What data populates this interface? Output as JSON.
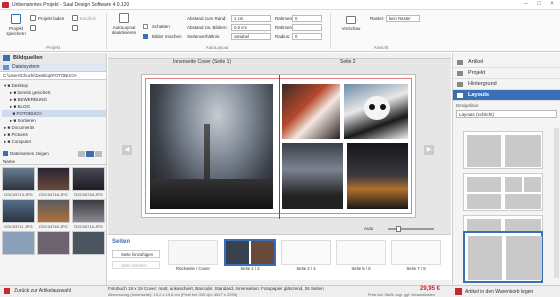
{
  "app": {
    "title": "Unbenanntes Projekt - Saal Design Software 4.0.120"
  },
  "ribbon": {
    "project": {
      "save": "Projekt speichern",
      "load": "Projekt laden",
      "recent": "Kürzlich",
      "group": "Projekt"
    },
    "autolayout": {
      "btn": "AutoLayout deaktivieren",
      "shadows": "Schatten",
      "images_mix": "Bilder mischen",
      "group": "AutoLayout",
      "edge_label": "Abstand zum Rand:",
      "edge_val": "1 cm",
      "between_label": "Abstand zw. Bildern:",
      "between_val": "0,5 cm",
      "ratio_label": "Seitenverhältnis:",
      "ratio_val": "variabel",
      "frame_label": "Rahmendicke:",
      "frame_val": "0",
      "framecolor_label": "Rahmenfarbe:",
      "radius_label": "Radius:",
      "radius_val": "0"
    },
    "view": {
      "preview": "Vorschau",
      "grid_label": "Raster:",
      "grid_val": "kein Raster",
      "group": "Ansicht"
    }
  },
  "left": {
    "title": "Bildquellen",
    "filesystem": "Dateisystem",
    "path": "C:\\Users\\Chuchi\\Desktop\\FOTOBUCH",
    "tree": [
      "Desktop",
      "bereits gesichert",
      "BEWERBUNG",
      "BLOG",
      "FOTOBUCH",
      "Sortieren",
      "Documents",
      "Pictures",
      "Computer"
    ],
    "show_names": "Dateinamen zeigen",
    "name_label": "Name",
    "thumbs": [
      "DSC03713.JPG",
      "DSC03718.JPG",
      "DSC03748.JPG",
      "DSC03711.JPG",
      "DSC03745.JPG",
      "DSC03716.JPG"
    ]
  },
  "center": {
    "page_left": "Innenseite Cover (Seite 1)",
    "page_right": "Seite 2",
    "zoom": "Auto",
    "pages_title": "Seiten",
    "add_pages": "Seite hinzufügen",
    "delete_page": "Seite löschen",
    "spreads": [
      "Rückseite / Cover",
      "Seite 1 / 2",
      "Seite 3 / 4",
      "Seite 5 / 6",
      "Seite 7 / 8"
    ]
  },
  "right": {
    "tabs": [
      "Artikel",
      "Projekt",
      "Hintergrund",
      "Layouts"
    ],
    "designlines_label": "Designlinie:",
    "designlines_val": "Layouts (schlicht)"
  },
  "footer": {
    "back": "Zurück zur Artikelauswahl",
    "summary": "Fotobuch 19 x 19 Cover: matt, unkaschiert, Barcode: Standard, Innenseiten: Fotopapier glänzend, 26 Seiten",
    "dims": "Abmessung (Innenseite): 19,2 x 19,6 cm (Pixel bei 300 dpi: 4527 x 2299)",
    "price": "29,95 €",
    "price_note": "Preis inkl. MwSt. zzgl. ggf. Versandkosten",
    "cart": "Artikel in den Warenkorb legen"
  },
  "colors": {
    "accent": "#3b6fb5",
    "brand": "#c8282d"
  }
}
